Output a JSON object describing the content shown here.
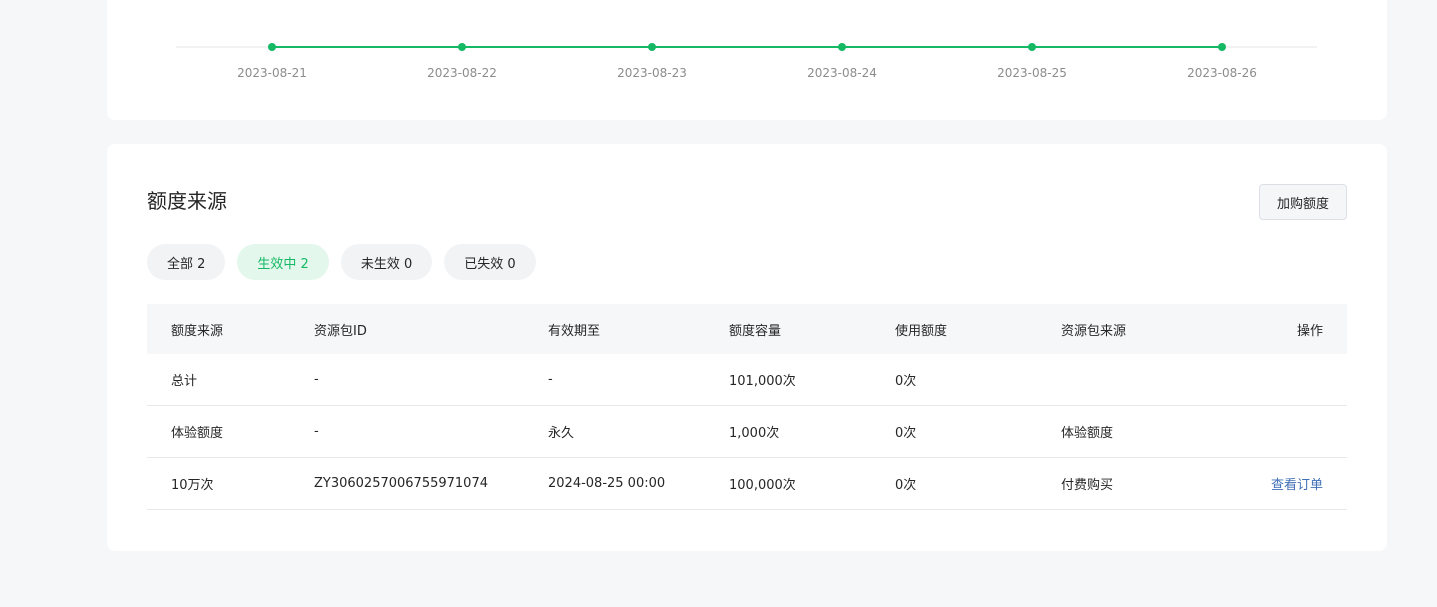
{
  "chart_data": {
    "type": "line",
    "x": [
      "2023-08-21",
      "2023-08-22",
      "2023-08-23",
      "2023-08-24",
      "2023-08-25",
      "2023-08-26"
    ],
    "series": [
      {
        "values": [
          0,
          0,
          0,
          0,
          0,
          0
        ],
        "color": "#15b964"
      }
    ],
    "grid": false
  },
  "source": {
    "title": "额度来源",
    "buy_button": "加购额度",
    "filters": [
      {
        "label": "全部 2",
        "active": false
      },
      {
        "label": "生效中 2",
        "active": true
      },
      {
        "label": "未生效 0",
        "active": false
      },
      {
        "label": "已失效 0",
        "active": false
      }
    ],
    "table": {
      "headers": [
        "额度来源",
        "资源包ID",
        "有效期至",
        "额度容量",
        "使用额度",
        "资源包来源",
        "操作"
      ],
      "rows": [
        [
          "总计",
          "-",
          "-",
          "101,000次",
          "0次",
          "",
          ""
        ],
        [
          "体验额度",
          "-",
          "永久",
          "1,000次",
          "0次",
          "体验额度",
          ""
        ],
        [
          "10万次",
          "ZY3060257006755971074",
          "2024-08-25 00:00",
          "100,000次",
          "0次",
          "付费购买",
          "查看订单"
        ]
      ]
    }
  },
  "colors": {
    "accent": "#15b964",
    "link": "#3f6fb5",
    "background": "#f6f7f9"
  }
}
